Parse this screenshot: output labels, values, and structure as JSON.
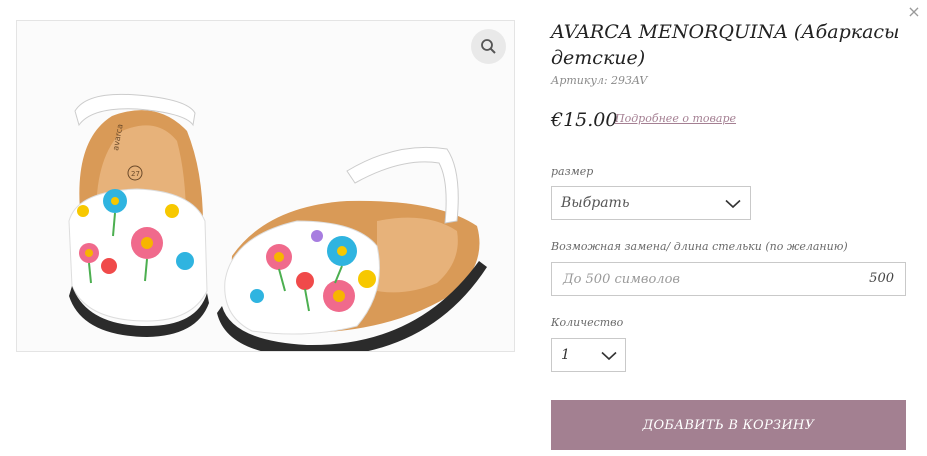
{
  "product": {
    "title": "AVARCA MENORQUINA (Абаркасы детские)",
    "sku": "Артикул: 293AV",
    "price": "€15.00",
    "more_link": "Подробнее о товаре"
  },
  "options": {
    "size_label": "размер",
    "size_value": "Выбрать",
    "note_label": "Возможная замена/ длина стельки (по желанию)",
    "note_placeholder": "До 500 символов",
    "note_counter": "500",
    "qty_label": "Количество",
    "qty_value": "1"
  },
  "actions": {
    "add_to_cart": "ДОБАВИТЬ В КОРЗИНУ",
    "close": "×"
  },
  "image": {
    "brand_stamp": "avarca",
    "size_stamp": "27"
  },
  "colors": {
    "accent": "#a38091",
    "link": "#a47f92",
    "border": "#c9c9c9"
  },
  "icons": [
    "close-icon",
    "search-icon",
    "chevron-down-icon"
  ]
}
